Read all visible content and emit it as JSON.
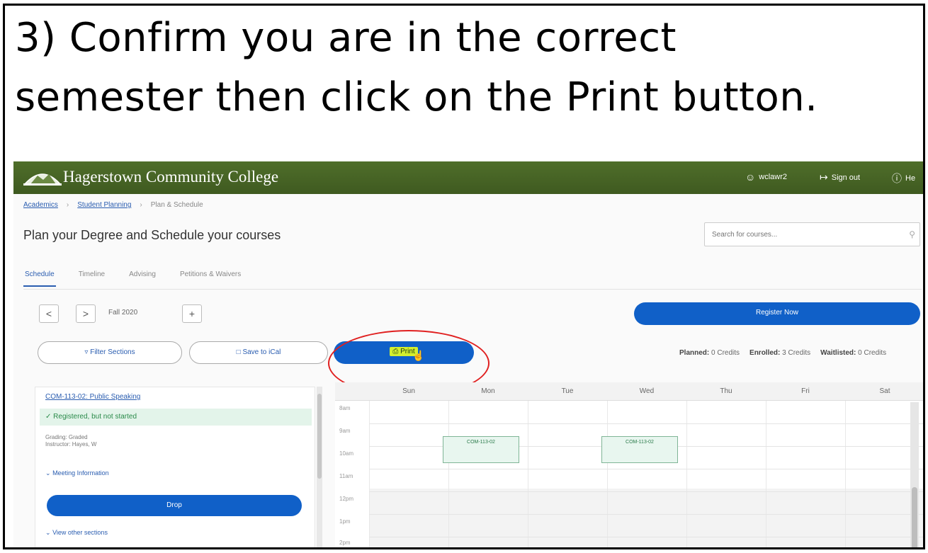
{
  "instruction": {
    "line1": "3) Confirm you are in the correct",
    "line2": "semester then click on the Print button."
  },
  "header": {
    "college_name": "Hagerstown Community College",
    "user": "wclawr2",
    "signout": "Sign out",
    "help": "He"
  },
  "breadcrumb": [
    "Academics",
    "Student Planning",
    "Plan & Schedule"
  ],
  "page": {
    "title": "Plan your Degree and Schedule your courses",
    "search_placeholder": "Search for courses..."
  },
  "tabs": [
    "Schedule",
    "Timeline",
    "Advising",
    "Petitions & Waivers"
  ],
  "term": {
    "prev": "<",
    "next": ">",
    "label": "Fall 2020",
    "add": "+"
  },
  "buttons": {
    "register_now": "Register Now",
    "filter_sections": "Filter Sections",
    "save_to_ical": "Save to iCal",
    "print": "Print",
    "drop": "Drop"
  },
  "credits": {
    "planned_label": "Planned:",
    "planned_value": "0 Credits",
    "enrolled_label": "Enrolled:",
    "enrolled_value": "3 Credits",
    "waitlisted_label": "Waitlisted:",
    "waitlisted_value": "0 Credits"
  },
  "course_card": {
    "course": "COM-113-02: Public Speaking",
    "status": "Registered, but not started",
    "details": [
      "Grading: Graded",
      "Instructor: Hayes, W"
    ],
    "meeting_info": "Meeting Information",
    "other_sections": "View other sections"
  },
  "calendar": {
    "days": [
      "Sun",
      "Mon",
      "Tue",
      "Wed",
      "Thu",
      "Fri",
      "Sat"
    ],
    "hours": [
      "8am",
      "9am",
      "10am",
      "11am",
      "12pm",
      "1pm",
      "2pm"
    ],
    "events": [
      {
        "day": "Mon",
        "label": "COM-113-02"
      },
      {
        "day": "Wed",
        "label": "COM-113-02"
      }
    ]
  },
  "colors": {
    "header_green": "#4f6e2a",
    "primary_blue": "#1060c8",
    "highlight_red": "#e02020",
    "print_highlight": "#d4ef2e"
  }
}
